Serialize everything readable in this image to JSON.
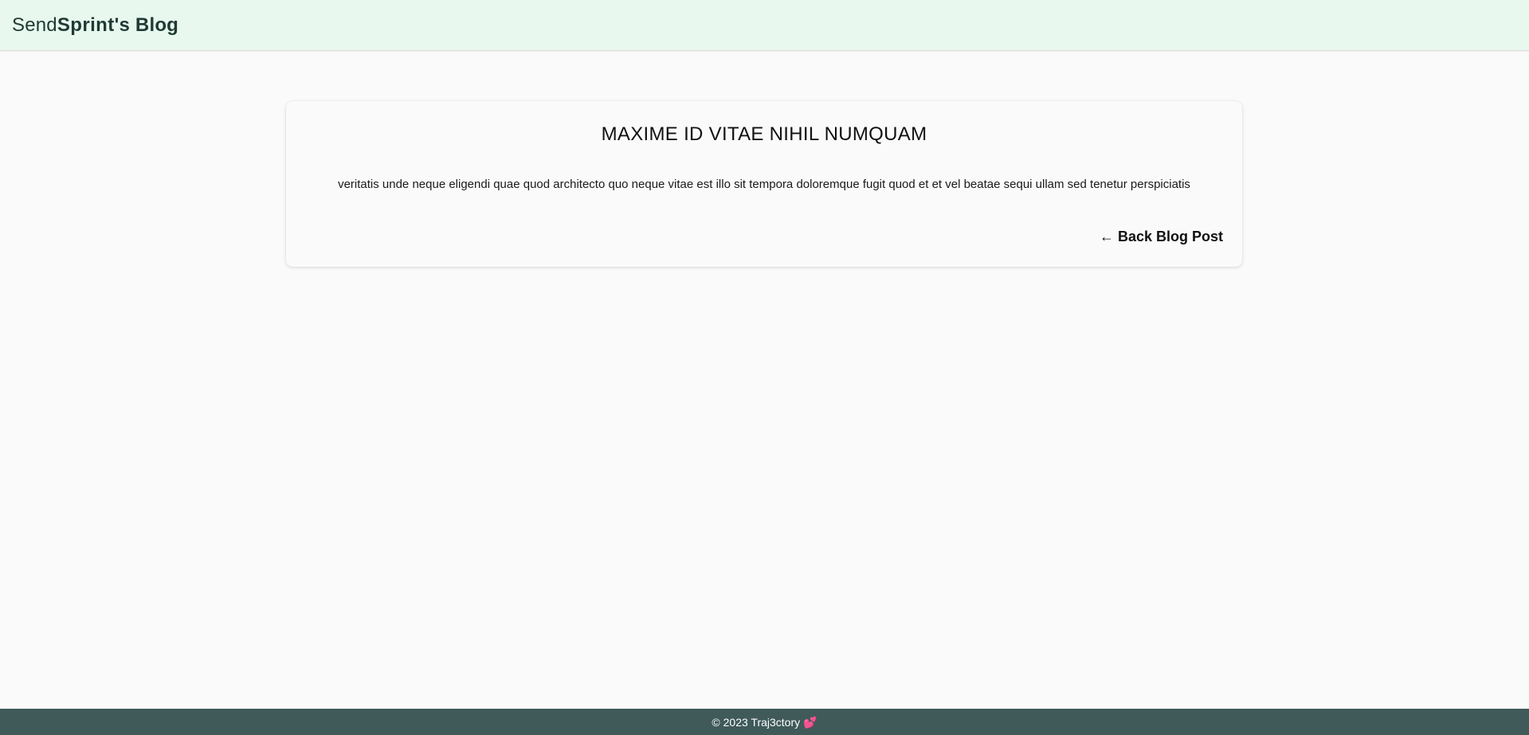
{
  "header": {
    "brand_send": "Send",
    "brand_sprint": "Sprint",
    "brand_suffix": "'s Blog"
  },
  "post": {
    "title": "MAXIME ID VITAE NIHIL NUMQUAM",
    "body": "veritatis unde neque eligendi quae quod architecto quo neque vitae est illo sit tempora doloremque fugit quod et et vel beatae sequi ullam sed tenetur perspiciatis",
    "back_arrow": "←",
    "back_label": "Back Blog Post"
  },
  "footer": {
    "text": "© 2023 Traj3ctory",
    "icon": "heart-icon",
    "heart_glyph": "💕"
  },
  "colors": {
    "header_bg": "#e8f8ee",
    "footer_bg": "#3f5a59",
    "page_bg": "#fafafa",
    "brand_text": "#1f3a33"
  }
}
